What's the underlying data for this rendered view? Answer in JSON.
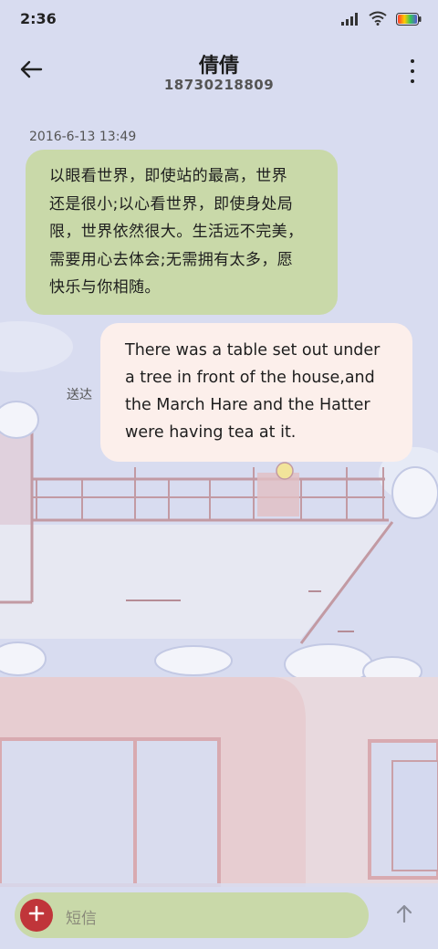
{
  "status_bar": {
    "time": "2:36"
  },
  "header": {
    "title": "倩倩",
    "phone": "18730218809"
  },
  "conversation": {
    "timestamp": "2016-6-13 13:49",
    "received": {
      "lines": [
        "以眼看世界，即使站的最高，世界",
        "还是很小;以心看世界，即使身处局",
        "限，世界依然很大。生活远不完美，",
        "需要用心去体会;无需拥有太多，愿",
        "快乐与你相随。"
      ]
    },
    "sent": {
      "lines": [
        "There was a table set out under",
        "a tree in front of the house,and",
        "the March Hare and the Hatter",
        "were having tea at it."
      ],
      "status": "送达"
    }
  },
  "composer": {
    "placeholder": "短信"
  },
  "colors": {
    "background": "#d8dcf0",
    "received_bubble": "#c9d9a9",
    "sent_bubble": "#fcefeb",
    "attach_button": "#c0353a"
  },
  "icons": [
    "signal-icon",
    "wifi-icon",
    "battery-icon",
    "back-arrow-icon",
    "more-vert-icon",
    "plus-icon",
    "send-arrow-icon"
  ]
}
